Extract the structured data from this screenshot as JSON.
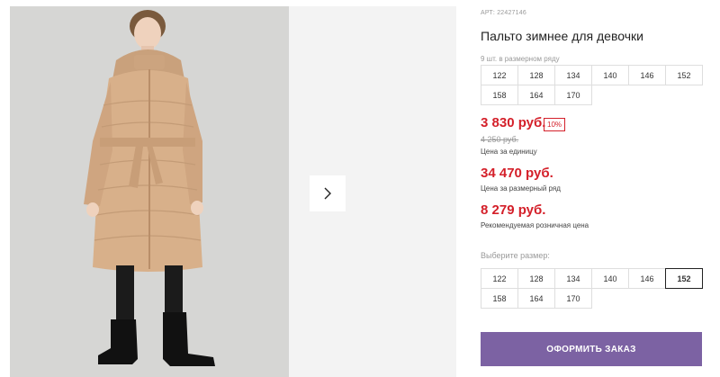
{
  "gallery": {
    "next_icon": "chevron-right-icon"
  },
  "product": {
    "sku": "АРТ: 22427146",
    "title": "Пальто зимнее для девочки",
    "pack_note": "9 шт. в размерном ряду"
  },
  "size_row_sizes": [
    "122",
    "128",
    "134",
    "140",
    "146",
    "152",
    "158",
    "164",
    "170"
  ],
  "prices": {
    "unit_price": "3 830 руб.",
    "discount": "10%",
    "old_price": "4 250 руб.",
    "unit_note": "Цена за единицу",
    "row_price": "34 470 руб.",
    "row_note": "Цена за размерный ряд",
    "rrp_price": "8 279 руб.",
    "rrp_note": "Рекомендуемая розничная цена"
  },
  "size_picker": {
    "label": "Выберите размер:",
    "sizes": [
      "122",
      "128",
      "134",
      "140",
      "146",
      "152",
      "158",
      "164",
      "170"
    ],
    "selected": "152"
  },
  "order_button": "ОФОРМИТЬ ЗАКАЗ",
  "colors": {
    "price_red": "#d4202a",
    "accent_purple": "#7c62a3"
  }
}
